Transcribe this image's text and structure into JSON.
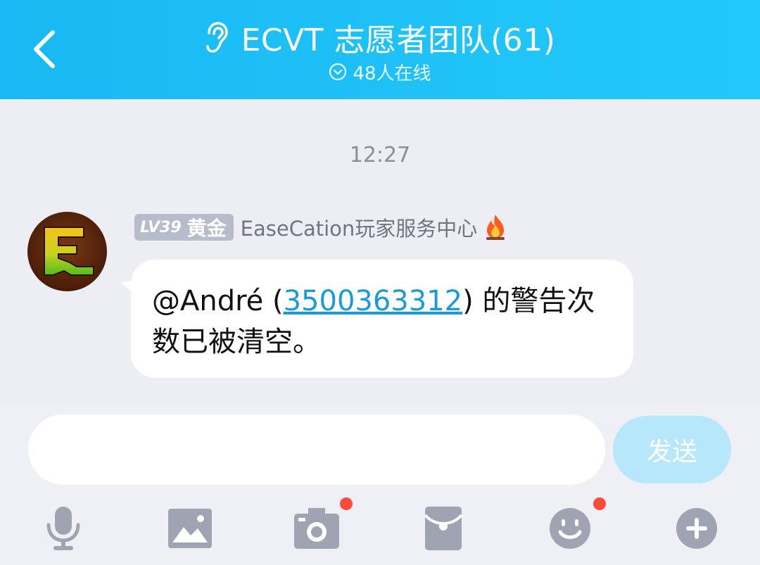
{
  "header": {
    "title": "ECVT 志愿者团队(61)",
    "online_status": "48人在线",
    "colors": {
      "background": "#1ec2f7",
      "text": "#ffffff"
    },
    "icons": {
      "back": "chevron-left-icon",
      "mode": "ear-icon",
      "expand": "chevron-down-circle-icon"
    }
  },
  "chat": {
    "timestamp": "12:27",
    "message": {
      "sender": {
        "level_label": "LV39",
        "tier_label": "黄金",
        "name": "EaseCation玩家服务中心",
        "badge_icon": "fire-icon",
        "avatar_icon": "easecation-logo"
      },
      "text_before": "@André (",
      "link_text": "3500363312",
      "text_after": ") 的警告次数已被清空。"
    }
  },
  "input_bar": {
    "input_value": "",
    "input_placeholder": "",
    "send_label": "发送",
    "send_color": "#b6e7fb",
    "toolbar": [
      {
        "name": "microphone-icon"
      },
      {
        "name": "image-icon"
      },
      {
        "name": "camera-icon",
        "has_notification": true
      },
      {
        "name": "red-packet-icon"
      },
      {
        "name": "emoji-icon",
        "has_notification": true
      },
      {
        "name": "plus-icon"
      }
    ]
  }
}
